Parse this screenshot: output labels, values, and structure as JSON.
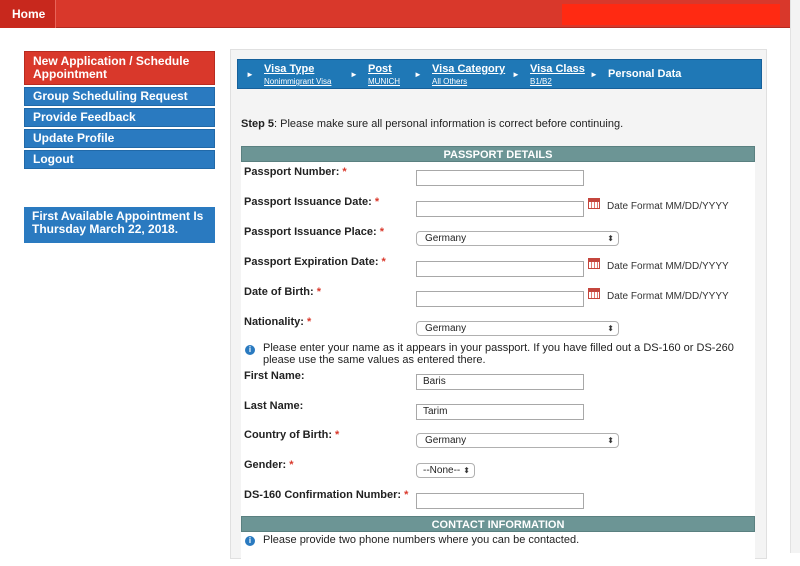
{
  "topbar": {
    "home_label": "Home"
  },
  "sidebar": {
    "items": [
      {
        "label": "New Application / Schedule Appointment"
      },
      {
        "label": "Group Scheduling Request"
      },
      {
        "label": "Provide Feedback"
      },
      {
        "label": "Update Profile"
      },
      {
        "label": "Logout"
      }
    ],
    "notice": "First Available Appointment Is Thursday March 22, 2018."
  },
  "breadcrumb": {
    "steps": [
      {
        "title": "Visa Type",
        "sub": "Nonimmigrant Visa"
      },
      {
        "title": "Post",
        "sub": "MUNICH"
      },
      {
        "title": "Visa Category",
        "sub": "All Others"
      },
      {
        "title": "Visa Class",
        "sub": "B1/B2"
      },
      {
        "title": "Personal Data",
        "sub": ""
      }
    ]
  },
  "step": {
    "prefix": "Step 5",
    "text": ": Please make sure all personal information is correct before continuing."
  },
  "passport": {
    "header": "PASSPORT DETAILS",
    "passport_number_label": "Passport Number:",
    "issuance_date_label": "Passport Issuance Date:",
    "issuance_place_label": "Passport Issuance Place:",
    "issuance_place_value": "Germany",
    "expiration_date_label": "Passport Expiration Date:",
    "dob_label": "Date of Birth:",
    "nationality_label": "Nationality:",
    "nationality_value": "Germany",
    "date_format": "Date Format MM/DD/YYYY",
    "name_info": "Please enter your name as it appears in your passport. If you have filled out a DS-160 or DS-260 please use the same values as entered there.",
    "first_name_label": "First Name:",
    "first_name_value": "Baris",
    "last_name_label": "Last Name:",
    "last_name_value": "Tarim",
    "country_birth_label": "Country of Birth:",
    "country_birth_value": "Germany",
    "gender_label": "Gender:",
    "gender_value": "--None--",
    "ds160_label": "DS-160 Confirmation Number:"
  },
  "contact": {
    "header": "CONTACT INFORMATION",
    "info": "Please provide two phone numbers where you can be contacted."
  },
  "required_mark": "*",
  "colors": {
    "topbar": "#d9382b",
    "nav_blue": "#2a7ac0",
    "section_header": "#6c9595"
  }
}
